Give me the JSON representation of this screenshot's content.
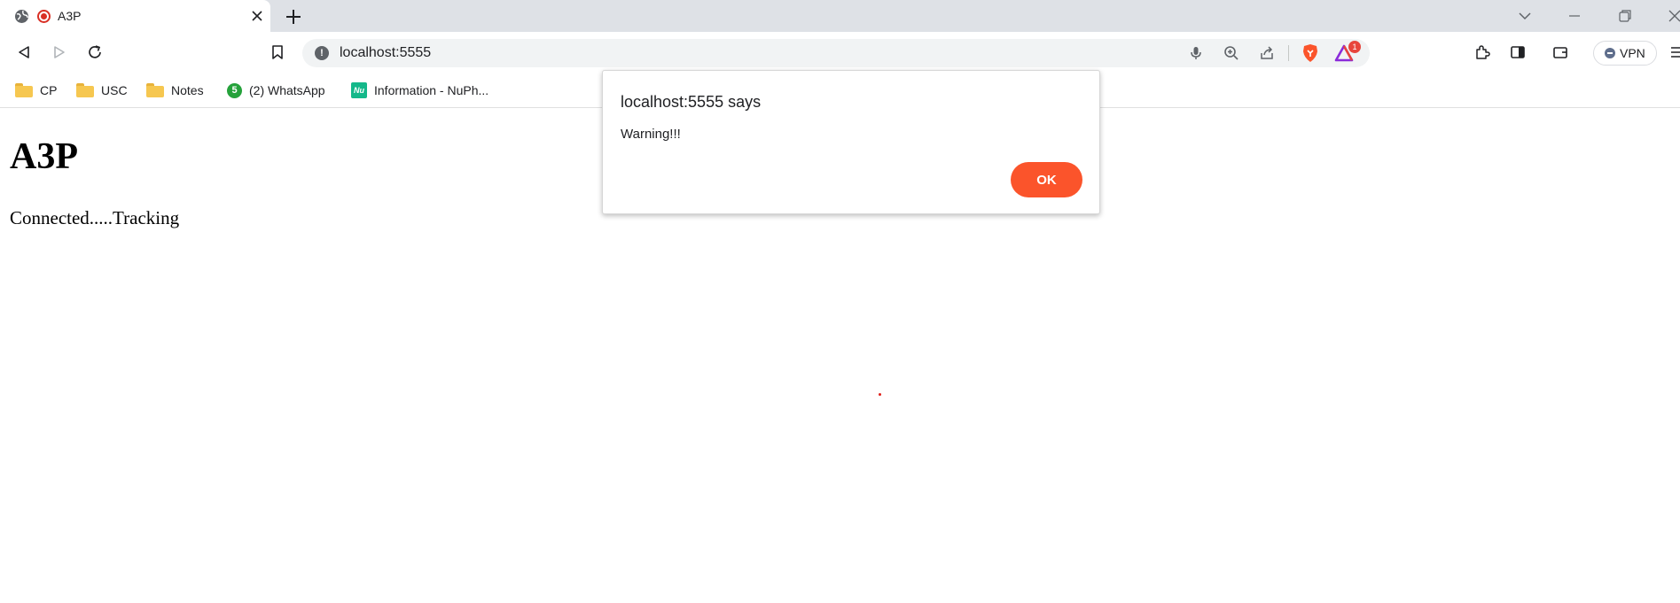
{
  "tab": {
    "title": "A3P"
  },
  "address_bar": {
    "url": "localhost:5555"
  },
  "rewards_badge": "1",
  "vpn": {
    "label": "VPN"
  },
  "bookmarks": [
    {
      "label": "CP",
      "icon": "folder-icon"
    },
    {
      "label": "USC",
      "icon": "folder-icon"
    },
    {
      "label": "Notes",
      "icon": "folder-icon"
    },
    {
      "label": "(2) WhatsApp",
      "icon": "whatsapp-icon",
      "icon_text": "5"
    },
    {
      "label": "Information - NuPh...",
      "icon": "nu-icon",
      "icon_text": "Nu"
    }
  ],
  "page": {
    "heading": "A3P",
    "status": "Connected.....Tracking"
  },
  "dialog": {
    "title": "localhost:5555 says",
    "message": "Warning!!!",
    "ok_label": "OK"
  },
  "colors": {
    "brave_orange": "#fb542b",
    "tab_strip": "#dee1e6",
    "recording_red": "#d93025"
  }
}
